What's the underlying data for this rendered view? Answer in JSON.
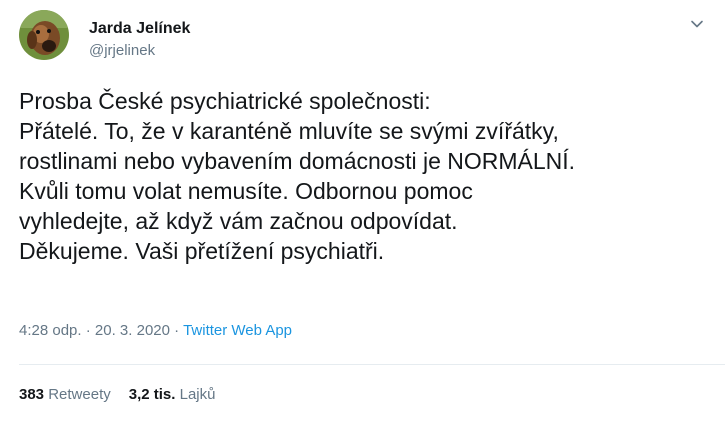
{
  "author": {
    "display_name": "Jarda Jelínek",
    "handle": "@jrjelinek",
    "avatar_icon": "dog-photo-avatar"
  },
  "menu_icon": "chevron-down-icon",
  "tweet": {
    "lines": [
      "Prosba České psychiatrické společnosti:",
      "Přátelé. To, že v karanténě mluvíte se svými zvířátky,",
      "rostlinami nebo vybavením domácnosti je NORMÁLNÍ.",
      "Kvůli tomu volat nemusíte. Odbornou pomoc",
      "vyhledejte, až když vám začnou odpovídat.",
      "Děkujeme. Vaši přetížení psychiatři."
    ]
  },
  "meta": {
    "time": "4:28 odp.",
    "separator": "·",
    "date": "20. 3. 2020",
    "source": "Twitter Web App"
  },
  "stats": {
    "retweets_count": "383",
    "retweets_label": "Retweety",
    "likes_count": "3,2 tis.",
    "likes_label": "Lajků"
  },
  "colors": {
    "text": "#14171a",
    "secondary": "#657786",
    "link": "#1b95e0",
    "divider": "#e6ecf0"
  }
}
